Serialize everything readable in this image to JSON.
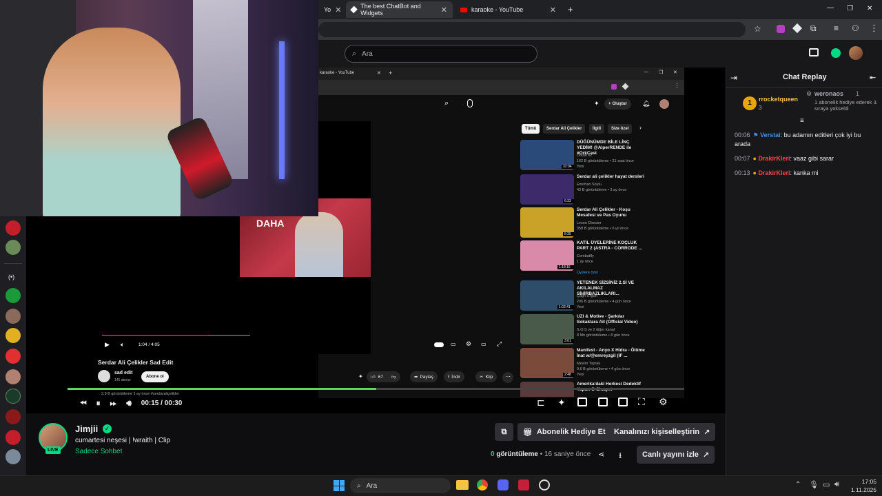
{
  "browser": {
    "tabs": [
      {
        "label": "Yo",
        "icon": "youtube-icon"
      },
      {
        "label": "The best ChatBot and Widgets",
        "icon": "streamelements-icon"
      },
      {
        "label": "karaoke - YouTube",
        "icon": "youtube-icon"
      }
    ],
    "new_tab": "+",
    "window_min": "—",
    "window_max": "❐",
    "window_close": "✕"
  },
  "twitch": {
    "search_placeholder": "Ara"
  },
  "inner_youtube": {
    "tab_label": "karaoke - YouTube",
    "create_label": "Oluştur",
    "chips": [
      "Tümü",
      "Serdar Ali Çelikler",
      "İlgili",
      "Size özel"
    ],
    "video_title": "Serdar Ali Çelikler Sad Edit",
    "channel": "sad edit",
    "subs": "145 abone",
    "subscribe": "Abone ol",
    "time": "1:04 / 4:05",
    "likes": "67",
    "share": "Paylaş",
    "download": "İndir",
    "clip": "Klip",
    "views_line": "2,9 B görüntüleme  1 ay önce  #serdaraliçelikler",
    "clip_caption": "DAHA",
    "recommendations": [
      {
        "title": "DÜĞÜNÜMDE BİLE LİNÇ YEDİM! @AlperRENDE ile #OrkCast",
        "channel": "Orkun v2",
        "meta": "162 B görüntüleme • 21 saat önce",
        "badge": "Yeni",
        "duration": "32:04",
        "color": "#2a4a7a"
      },
      {
        "title": "Serdar ali çelikler hayat dersleri",
        "channel": "Emirhan Soylu",
        "meta": "43 B görüntüleme • 3 ay önce",
        "badge": "",
        "duration": "6:33",
        "color": "#3d2a6a"
      },
      {
        "title": "Serdar Ali Çelikler - Koşu Mesafesi ve Pas Oyunu",
        "channel": "Lesen Director",
        "meta": "358 B görüntüleme • 6 yıl önce",
        "badge": "",
        "duration": "8:35",
        "color": "#c9a227"
      },
      {
        "title": "KATIL ÜYELERİNE KOÇLUK PART 2 (ASTRA - CORRODE ...",
        "channel": "Combatfly",
        "meta": "1 ay önce",
        "badge": "Üyelere özel",
        "duration": "1:18:16",
        "color": "#d98aa8"
      },
      {
        "title": "YETENEK SİZSİNİZ 2.Sİ VE AKILALMAZ SİHİRBAZLIKLARI...",
        "channel": "Çağrı Ergün",
        "meta": "206 B görüntüleme • 4 gün önce",
        "badge": "Yeni",
        "duration": "1:02:41",
        "color": "#2d4d6a"
      },
      {
        "title": "UZI & Motive - Şarkılar Sokaklara Ait (Official Video)",
        "channel": "S.O.S ve 2 diğer kanal",
        "meta": "8 Mn görüntüleme • 8 gün önce",
        "badge": "",
        "duration": "3:01",
        "color": "#4a5a4a"
      },
      {
        "title": "Manifest - Anyo X Hidra - Ölüme İnat w/@emreyzgil (IF ...",
        "channel": "Mesim Toprak",
        "meta": "9,6 B görüntüleme • 4 gün önce",
        "badge": "Yeni",
        "duration": "2:48",
        "color": "#7a4a3a"
      },
      {
        "title": "Amerika'daki Herkesi Dedektif Yapan O Cinayet",
        "channel": "",
        "meta": "",
        "badge": "",
        "duration": "",
        "color": "#5a3a3a"
      }
    ]
  },
  "player": {
    "time": "00:15 / 00:30",
    "progress_fraction": 0.5
  },
  "chat": {
    "title": "Chat Replay",
    "leaderboard": [
      {
        "rank": "1",
        "name": "rrocketqueen",
        "count": "3"
      },
      {
        "rank": "",
        "name": "weronaos",
        "count": "1",
        "note": "1 abonelik hediye ederek 3. sıraya yükseldi"
      }
    ],
    "messages": [
      {
        "ts": "00:06",
        "user": "Verstai",
        "user_color": "#4a90e2",
        "text": ": bu adamın editleri çok iyi bu arada"
      },
      {
        "ts": "00:07",
        "user": "DrakirKleri",
        "user_color": "#ff4444",
        "text": ": vaaz gibi sarar"
      },
      {
        "ts": "00:13",
        "user": "DrakirKleri",
        "user_color": "#ff4444",
        "text": ": kanka mi"
      }
    ]
  },
  "channel": {
    "name": "Jimjii",
    "live": "LIVE",
    "title": "cumartesi neşesi | !wraith | Clip",
    "category": "Sadece Sohbet",
    "gift_btn": "Abonelik Hediye Et",
    "customize_btn": "Kanalınızı kişiselleştirin",
    "views": "0",
    "views_label": "görüntüleme",
    "ago": "• 16 saniye önce",
    "watch_live": "Canlı yayını izle"
  },
  "taskbar": {
    "search": "Ara",
    "time": "17:05",
    "date": "1.11.2025"
  },
  "colors": {
    "twitch_green": "#00db84",
    "accent_purple": "#9147ff"
  }
}
